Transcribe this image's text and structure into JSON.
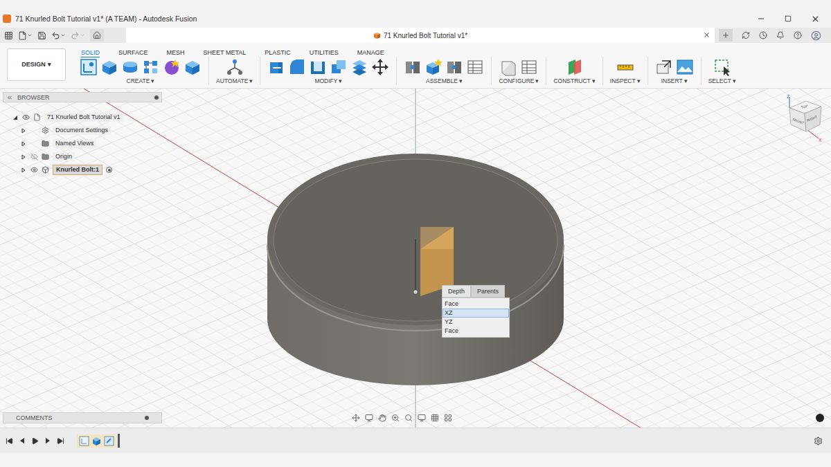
{
  "window": {
    "title": "71 Knurled Bolt Tutorial v1* (A TEAM) - Autodesk Fusion"
  },
  "document_tab": {
    "title": "71 Knurled Bolt Tutorial v1*"
  },
  "workspace": {
    "label": "DESIGN",
    "caret": "▾"
  },
  "toolbar_tabs": [
    {
      "label": "SOLID",
      "selected": true
    },
    {
      "label": "SURFACE",
      "selected": false
    },
    {
      "label": "MESH",
      "selected": false
    },
    {
      "label": "SHEET METAL",
      "selected": false
    },
    {
      "label": "PLASTIC",
      "selected": false
    },
    {
      "label": "UTILITIES",
      "selected": false
    },
    {
      "label": "MANAGE",
      "selected": false
    }
  ],
  "tool_groups": [
    {
      "label": "CREATE",
      "caret": "▾"
    },
    {
      "label": "AUTOMATE",
      "caret": "▾"
    },
    {
      "label": "MODIFY",
      "caret": "▾"
    },
    {
      "label": "ASSEMBLE",
      "caret": "▾"
    },
    {
      "label": "CONFIGURE",
      "caret": "▾"
    },
    {
      "label": "CONSTRUCT",
      "caret": "▾"
    },
    {
      "label": "INSPECT",
      "caret": "▾"
    },
    {
      "label": "INSERT",
      "caret": "▾"
    },
    {
      "label": "SELECT",
      "caret": "▾"
    }
  ],
  "browser": {
    "title": "BROWSER",
    "items": [
      {
        "label": "71 Knurled Bolt Tutorial v1",
        "kind": "document",
        "depth": 0,
        "expanded": true,
        "visibility": "shown",
        "selected": false,
        "active": false
      },
      {
        "label": "Document Settings",
        "kind": "settings",
        "depth": 1,
        "expanded": false,
        "visibility": "none",
        "selected": false,
        "active": false
      },
      {
        "label": "Named Views",
        "kind": "folder",
        "depth": 1,
        "expanded": false,
        "visibility": "none",
        "selected": false,
        "active": false
      },
      {
        "label": "Origin",
        "kind": "folder",
        "depth": 1,
        "expanded": false,
        "visibility": "hidden",
        "selected": false,
        "active": false
      },
      {
        "label": "Knurled Bolt:1",
        "kind": "component",
        "depth": 1,
        "expanded": false,
        "visibility": "shown",
        "selected": true,
        "active": true
      }
    ]
  },
  "comments": {
    "title": "COMMENTS"
  },
  "context_menu": {
    "tabs": [
      {
        "label": "Depth",
        "selected": true
      },
      {
        "label": "Parents",
        "selected": false
      }
    ],
    "items": [
      {
        "label": "Face",
        "selected": false
      },
      {
        "label": "XZ",
        "selected": true
      },
      {
        "label": "YZ",
        "selected": false
      },
      {
        "label": "Face",
        "selected": false
      }
    ]
  },
  "viewcube": {
    "faces": [
      "TOP",
      "FRONT",
      "RIGHT"
    ],
    "axes": [
      "Z",
      "X"
    ]
  }
}
